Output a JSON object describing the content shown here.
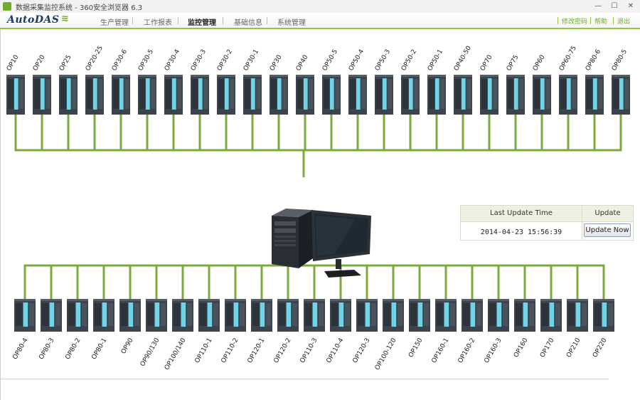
{
  "window": {
    "title": "数据采集监控系统 - 360安全浏览器 6.3",
    "minimize_glyph": "—",
    "maximize_glyph": "☐",
    "close_glyph": "✕"
  },
  "app": {
    "logo": "AutoDAS"
  },
  "nav": {
    "items": [
      {
        "label": "生产管理"
      },
      {
        "label": "工作报表"
      },
      {
        "label": "监控管理",
        "active": true
      },
      {
        "label": "基础信息"
      },
      {
        "label": "系统管理"
      }
    ]
  },
  "toolbar": {
    "password_label": "修改密码",
    "help_label": "帮助",
    "exit_label": "退出"
  },
  "stations_top": [
    "OP10",
    "OP20",
    "OP25",
    "OP20-25",
    "OP30-6",
    "OP30-5",
    "OP30-4",
    "OP30-3",
    "OP30-2",
    "OP30-1",
    "OP30",
    "OP40",
    "OP50-5",
    "OP50-4",
    "OP50-3",
    "OP50-2",
    "OP50-1",
    "OP40-50",
    "OP70",
    "OP75",
    "OP60",
    "OP60-75",
    "OP80-6",
    "OP80-5"
  ],
  "stations_bottom": [
    "OP80-4",
    "OP80-3",
    "OP80-2",
    "OP80-1",
    "OP90",
    "OP90/130",
    "OP100/140",
    "OP110-1",
    "OP110-2",
    "OP120-1",
    "OP120-2",
    "OP110-3",
    "OP110-4",
    "OP120-3",
    "OP100-120",
    "OP150",
    "OP160-1",
    "OP160-2",
    "OP160-3",
    "OP160",
    "OP170",
    "OP210",
    "OP220"
  ],
  "update_panel": {
    "col_time": "Last Update Time",
    "col_update": "Update",
    "time_value": "2014-04-23 15:56:39",
    "button_label": "Update Now"
  },
  "colors": {
    "bus": "#7aab3a",
    "plc_dark": "#3b444c",
    "plc_accent": "#6fd4e8",
    "menu_accent": "#8dc63f"
  },
  "icons": {
    "server": "computer-tower-icon",
    "monitor": "monitor-icon",
    "plc": "plc-module-icon"
  }
}
